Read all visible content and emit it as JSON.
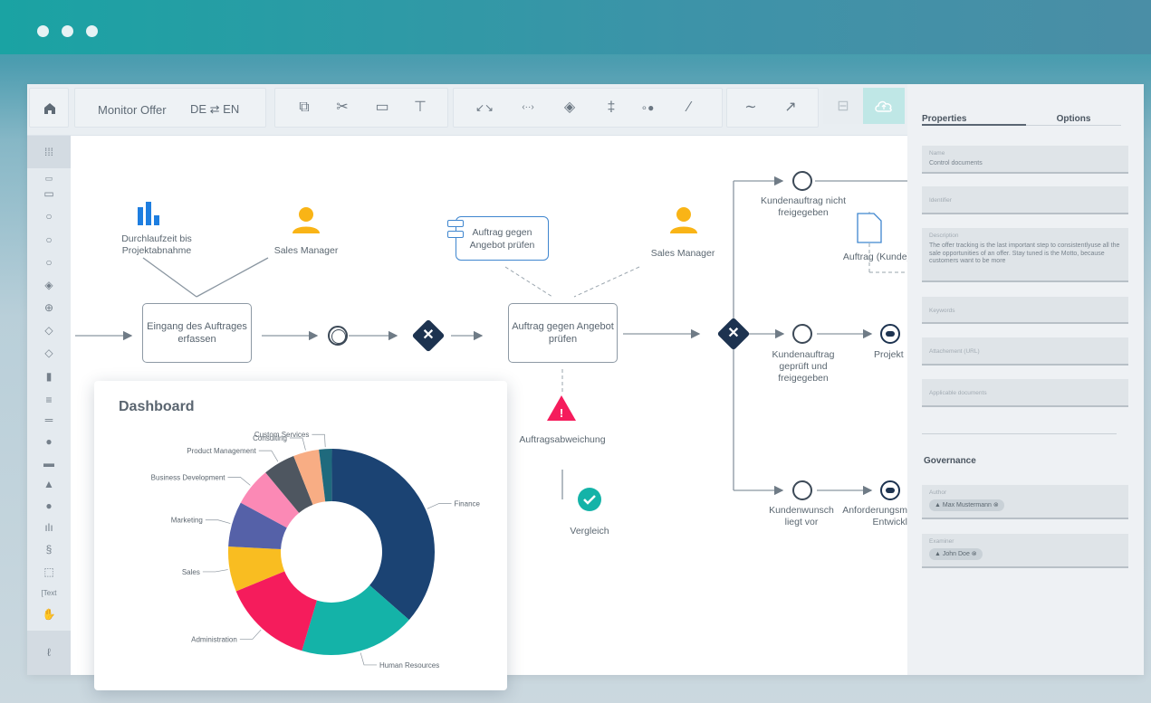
{
  "window": {
    "dots": 3
  },
  "toolbar": {
    "home_icon": "home-icon",
    "title": "Monitor Offer",
    "lang_switch": "DE ⇄ EN",
    "icons": [
      "copy-icon",
      "cut-icon",
      "paste-icon",
      "format-paint-icon",
      "connector-curve-icon",
      "connector-both-icon",
      "layers-icon",
      "align-icon",
      "connect-dots-icon",
      "magic-wand-icon",
      "curve-icon",
      "trend-icon",
      "save-icon",
      "upload-cloud-icon"
    ]
  },
  "properties": {
    "tabs": [
      "Properties",
      "Options"
    ],
    "fields": [
      {
        "label": "Name",
        "value": "Control documents"
      },
      {
        "label": "Identifier",
        "value": ""
      },
      {
        "label": "Description",
        "value": "The offer tracking is the last important  step to consistentlyuse all the sale opportunities of an offer. Stay tuned is the Motto, because customers want to be more"
      },
      {
        "label": "Keywords",
        "value": ""
      },
      {
        "label": "Attachement (URL)",
        "value": ""
      },
      {
        "label": "Applicable documents",
        "value": ""
      }
    ],
    "governance_title": "Governance",
    "author": {
      "label": "Author",
      "value": "Max Mustermann"
    },
    "examiner": {
      "label": "Examiner",
      "value": "John Doe"
    }
  },
  "diagram": {
    "kpi_label": "Durchlaufzeit bis Projektabnahme",
    "role1": "Sales Manager",
    "task1": "Eingang des Auftrages erfassen",
    "doc_task": "Auftrag gegen Angebot prüfen",
    "role2": "Sales Manager",
    "task2": "Auftrag gegen Angebot prüfen",
    "risk": "Auftragsabweichung",
    "check": "Vergleich",
    "branch1": "Kundenauftrag nicht freigegeben",
    "document": "Auftrag (Kunde)",
    "branch2": "Kundenauftrag geprüft und freigegeben",
    "branch2_end": "Projekt",
    "branch3": "Kundenwunsch liegt vor",
    "branch3_end": "Anforderungsm Entwickl"
  },
  "dashboard": {
    "title": "Dashboard"
  },
  "chart_data": {
    "type": "pie",
    "title": "Dashboard",
    "donut": true,
    "slices": [
      {
        "label": "Finance",
        "value": 36,
        "color": "#1b4373"
      },
      {
        "label": "Human Resources",
        "value": 18,
        "color": "#14b3a8"
      },
      {
        "label": "Administration",
        "value": 14,
        "color": "#f51c5c"
      },
      {
        "label": "Sales",
        "value": 7,
        "color": "#f9bd21"
      },
      {
        "label": "Marketing",
        "value": 7,
        "color": "#5561a8"
      },
      {
        "label": "Business Development",
        "value": 6,
        "color": "#fb89b5"
      },
      {
        "label": "Product Management",
        "value": 5,
        "color": "#4e5660"
      },
      {
        "label": "Consulting",
        "value": 4,
        "color": "#f8ad84"
      },
      {
        "label": "Custom Services",
        "value": 2,
        "color": "#1f6a7d"
      }
    ]
  }
}
